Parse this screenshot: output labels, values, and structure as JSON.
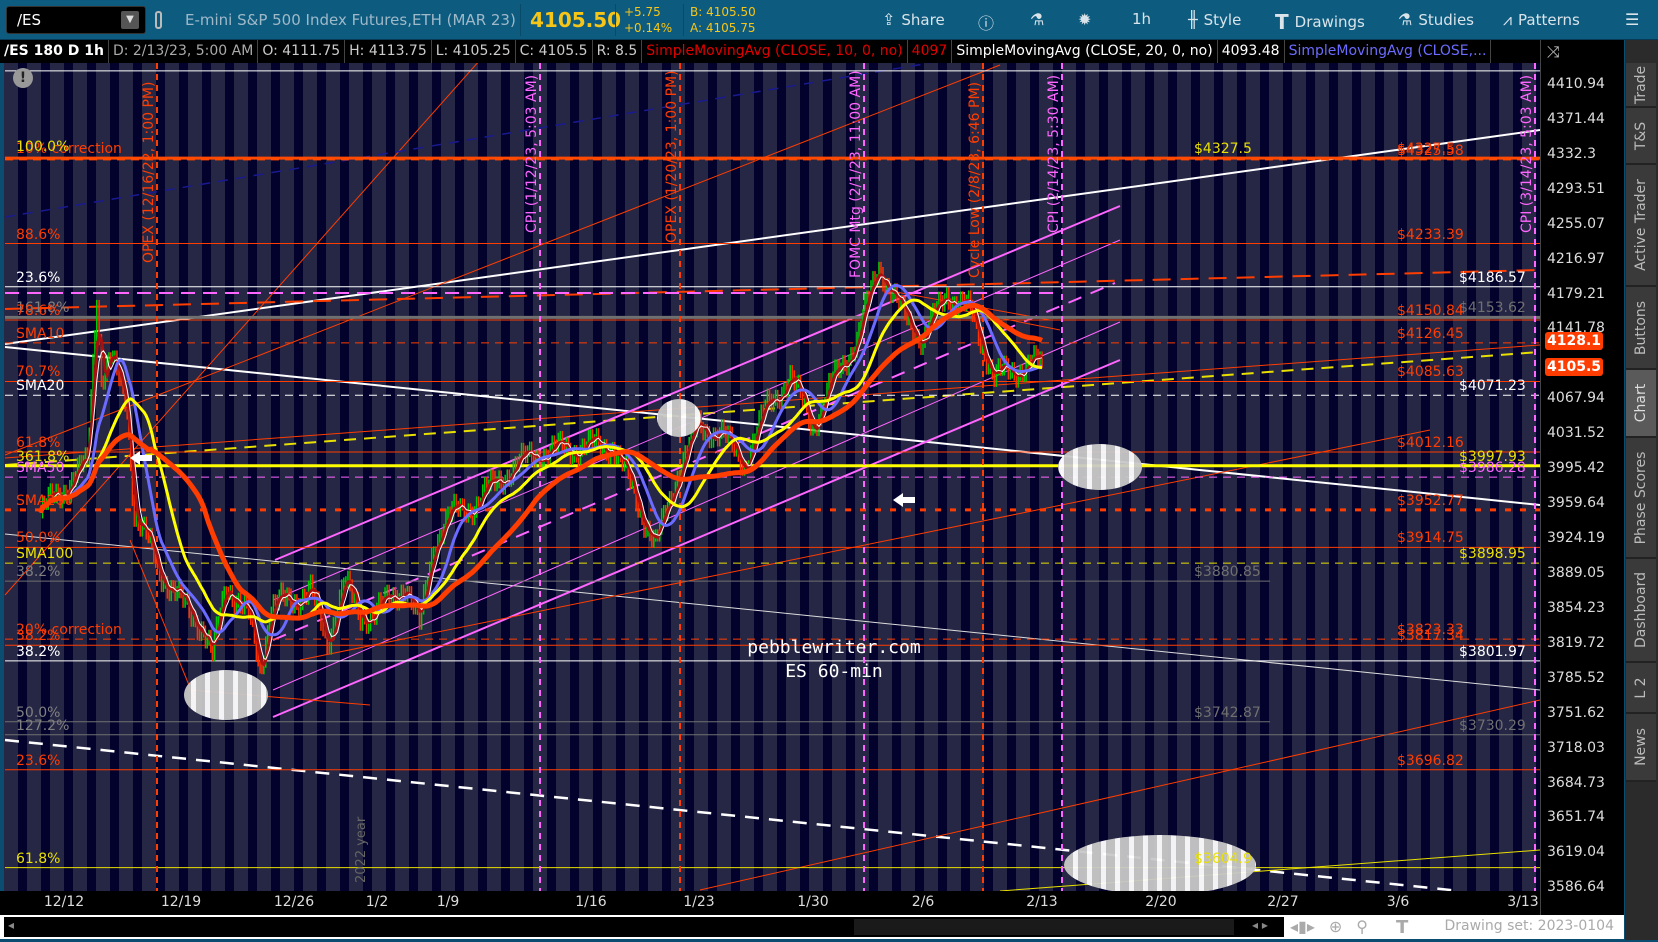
{
  "toolbar": {
    "symbol": "/ES",
    "description": "E-mini S&P 500 Index Futures,ETH (MAR 23)",
    "last": "4105.50",
    "change": "+5.75",
    "change_pct": "+0.14%",
    "bid": "B: 4105.50",
    "ask": "A: 4105.75",
    "share": "Share",
    "timeframe": "1h",
    "style": "Style",
    "drawings": "Drawings",
    "studies": "Studies",
    "patterns": "Patterns"
  },
  "info": {
    "chart_id": "/ES 180 D 1h",
    "date": "D: 2/13/23, 5:00 AM",
    "open": "O: 4111.75",
    "high": "H: 4113.75",
    "low": "L: 4105.25",
    "close": "C: 4105.5",
    "range": "R: 8.5",
    "sma10": "SimpleMovingAvg (CLOSE, 10, 0, no)",
    "sma10_val": "4097",
    "sma20": "SimpleMovingAvg (CLOSE, 20, 0, no)",
    "sma20_val": "4093.48",
    "sma_more": "SimpleMovingAvg (CLOSE,..."
  },
  "price_axis": {
    "ticks": [
      "4410.94",
      "4371.44",
      "4332.3",
      "4293.51",
      "4255.07",
      "4216.97",
      "4179.21",
      "4141.78",
      "4067.94",
      "4031.52",
      "3995.42",
      "3959.64",
      "3924.19",
      "3889.05",
      "3854.23",
      "3819.72",
      "3785.52",
      "3751.62",
      "3718.03",
      "3684.73",
      "3651.74",
      "3619.04",
      "3586.64"
    ],
    "badges": [
      {
        "text": "4128.1",
        "price": 4128.1
      },
      {
        "text": "4105.5",
        "price": 4105.5
      }
    ]
  },
  "time_axis": [
    "12/12",
    "12/19",
    "12/26",
    "1/2",
    "1/9",
    "1/16",
    "1/23",
    "1/30",
    "2/6",
    "2/13",
    "2/20",
    "2/27",
    "3/6",
    "3/13"
  ],
  "levels": [
    {
      "price": 4425.85,
      "color": "#ffffff",
      "style": "solid"
    },
    {
      "price": 4327.5,
      "color": "#ff4a00",
      "style": "thick",
      "left": "10% correction",
      "left_color": "#ff3d00",
      "left2": "100.0%",
      "left2_color": "#e8e000",
      "right": "$4327.5",
      "right_color": "#ff3d00",
      "mid": "$4327.5",
      "mid_color": "#e8e000"
    },
    {
      "price": 4325.58,
      "color": "#ff4a00",
      "style": "dashed",
      "right": "$4325.58",
      "right_color": "#ff3d00"
    },
    {
      "price": 4233.39,
      "color": "#ff3d00",
      "style": "solid",
      "left": "88.6%",
      "left_color": "#ff3d00",
      "right": "$4233.39",
      "right_color": "#ff3d00"
    },
    {
      "price": 4186.57,
      "color": "#ffffff",
      "style": "solid",
      "left": "23.6%",
      "left_color": "#ffffff",
      "right": "$4186.57",
      "right_color": "#ffffff"
    },
    {
      "price": 4153.62,
      "color": "#707070",
      "style": "thick",
      "left": "161.8%",
      "left_color": "#808080",
      "right": "$4153.62",
      "right_color": "#707070"
    },
    {
      "price": 4150.84,
      "color": "#ff3d00",
      "style": "solid",
      "left": "78.6%",
      "left_color": "#ff3d00",
      "right": "$4150.84",
      "right_color": "#ff3d00"
    },
    {
      "price": 4126.45,
      "color": "#ff3d00",
      "style": "dashed",
      "left": "SMA10",
      "left_color": "#ff3d00",
      "right": "$4126.45",
      "right_color": "#ff3d00"
    },
    {
      "price": 4085.63,
      "color": "#ff3d00",
      "style": "solid",
      "left": "70.7%",
      "left_color": "#ff3d00",
      "right": "$4085.63",
      "right_color": "#ff3d00"
    },
    {
      "price": 4071.23,
      "color": "#ffffff",
      "style": "dashed",
      "left": "SMA20",
      "left_color": "#ffffff",
      "right": "$4071.23",
      "right_color": "#ffffff"
    },
    {
      "price": 4012.16,
      "color": "#ff3d00",
      "style": "solid",
      "left": "61.8%",
      "left_color": "#ff3d00",
      "right": "$4012.16",
      "right_color": "#ff3d00"
    },
    {
      "price": 3997.93,
      "color": "#ffff00",
      "style": "thick",
      "left": "361.8%",
      "left_color": "#e8e000",
      "right": "$3997.93",
      "right_color": "#e8e000"
    },
    {
      "price": 3986.28,
      "color": "#ff66ff",
      "style": "dashed",
      "left": "SMA50",
      "left_color": "#ff66ff",
      "right": "$3986.28",
      "right_color": "#ff66ff"
    },
    {
      "price": 3952.77,
      "color": "#ff3d00",
      "style": "dotted",
      "left": "SMA200",
      "left_color": "#ff3d00",
      "right": "$3952.77",
      "right_color": "#ff3d00"
    },
    {
      "price": 3914.75,
      "color": "#ff3d00",
      "style": "solid",
      "left": "50.0%",
      "left_color": "#ff3d00",
      "right": "$3914.75",
      "right_color": "#ff3d00"
    },
    {
      "price": 3898.95,
      "color": "#e8e000",
      "style": "dashed",
      "left": "SMA100",
      "left_color": "#e8e000",
      "right": "$3898.95",
      "right_color": "#e8e000"
    },
    {
      "price": 3880.85,
      "color": "#707070",
      "style": "short",
      "left": "38.2%",
      "left_color": "#808080",
      "mid": "$3880.85",
      "mid_color": "#707070"
    },
    {
      "price": 3823.33,
      "color": "#ff3d00",
      "style": "dashed",
      "left": "20% correction",
      "left_color": "#ff3d00",
      "right": "$3823.33",
      "right_color": "#ff3d00"
    },
    {
      "price": 3817.34,
      "color": "#ff3d00",
      "style": "solid",
      "left": "38.2%",
      "left_color": "#ff3d00",
      "right": "$3817.34",
      "right_color": "#ff3d00"
    },
    {
      "price": 3801.97,
      "color": "#ffffff",
      "style": "solid",
      "left": "38.2%",
      "left_color": "#ffffff",
      "right": "$3801.97",
      "right_color": "#ffffff"
    },
    {
      "price": 3742.87,
      "color": "#707070",
      "style": "short",
      "left": "50.0%",
      "left_color": "#808080",
      "mid": "$3742.87",
      "mid_color": "#707070"
    },
    {
      "price": 3730.29,
      "color": "#707070",
      "style": "solid",
      "left": "127.2%",
      "left_color": "#808080",
      "right": "$3730.29",
      "right_color": "#707070"
    },
    {
      "price": 3696.82,
      "color": "#ff3d00",
      "style": "solid",
      "left": "23.6%",
      "left_color": "#ff3d00",
      "right": "$3696.82",
      "right_color": "#ff3d00"
    },
    {
      "price": 3604.9,
      "color": "#e8e000",
      "style": "solid",
      "left": "61.8%",
      "left_color": "#e8e000",
      "mid": "$3604.9",
      "mid_color": "#e8e000"
    }
  ],
  "events": [
    {
      "label": "OPEX (12/16/22, 1:00 PM)",
      "color": "#ff3d00"
    },
    {
      "label": "CPI (1/12/23, 5:03 AM)",
      "color": "#ff66ff"
    },
    {
      "label": "OPEX (1/20/23, 1:00 PM)",
      "color": "#ff3d00"
    },
    {
      "label": "FOMC Mtg (2/1/23, 11:00 AM)",
      "color": "#ff66ff"
    },
    {
      "label": "Cycle Low (2/8/23, 6:46 PM)",
      "color": "#ff3d00"
    },
    {
      "label": "CPI (2/14/23, 5:30 AM)",
      "color": "#ff66ff"
    },
    {
      "label": "CPI (3/14/23, 5:03 AM)",
      "color": "#ff66ff"
    }
  ],
  "watermark": {
    "line1": "pebblewriter.com",
    "line2": "ES 60-min",
    "year": "2022 year"
  },
  "price_path": [
    [
      "12/9",
      3950
    ],
    [
      "12/12",
      3975
    ],
    [
      "12/13",
      4000
    ],
    [
      "12/13.4",
      4180
    ],
    [
      "12/13.6",
      4090
    ],
    [
      "12/14",
      4110
    ],
    [
      "12/14.7",
      4060
    ],
    [
      "12/15",
      3950
    ],
    [
      "12/15.6",
      3920
    ],
    [
      "12/16",
      3895
    ],
    [
      "12/19",
      3860
    ],
    [
      "12/20",
      3835
    ],
    [
      "12/20.4",
      3805
    ],
    [
      "12/21",
      3880
    ],
    [
      "12/22",
      3845
    ],
    [
      "12/22.5",
      3795
    ],
    [
      "12/23",
      3855
    ],
    [
      "12/27",
      3870
    ],
    [
      "12/28",
      3820
    ],
    [
      "12/29",
      3880
    ],
    [
      "12/30",
      3845
    ],
    [
      "1/3",
      3860
    ],
    [
      "1/4",
      3880
    ],
    [
      "1/5",
      3835
    ],
    [
      "1/6",
      3920
    ],
    [
      "1/9",
      3945
    ],
    [
      "1/10",
      3960
    ],
    [
      "1/11",
      3990
    ],
    [
      "1/12",
      4010
    ],
    [
      "1/13",
      4015
    ],
    [
      "1/17",
      4020
    ],
    [
      "1/18",
      3970
    ],
    [
      "1/19",
      3915
    ],
    [
      "1/20",
      3990
    ],
    [
      "1/23",
      4040
    ],
    [
      "1/24",
      4030
    ],
    [
      "1/25",
      4000
    ],
    [
      "1/26",
      4060
    ],
    [
      "1/27",
      4090
    ],
    [
      "1/30",
      4040
    ],
    [
      "1/31",
      4090
    ],
    [
      "2/1",
      4130
    ],
    [
      "2/2",
      4210
    ],
    [
      "2/3",
      4160
    ],
    [
      "2/6",
      4130
    ],
    [
      "2/7",
      4180
    ],
    [
      "2/8",
      4160
    ],
    [
      "2/9",
      4090
    ],
    [
      "2/10",
      4100
    ],
    [
      "2/13",
      4105.5
    ]
  ],
  "bottom": {
    "drawing_set": "Drawing set: 2023-0104"
  },
  "side_tabs": [
    "Trade",
    "T&S",
    "Active Trader",
    "Buttons",
    "Chart",
    "Phase Scores",
    "Dashboard",
    "L 2",
    "News"
  ],
  "colors": {
    "toolbar": "#0e5b80",
    "chart_bg": "#262645",
    "accent": "#f5c518",
    "price_badge": "#ff3d00"
  }
}
